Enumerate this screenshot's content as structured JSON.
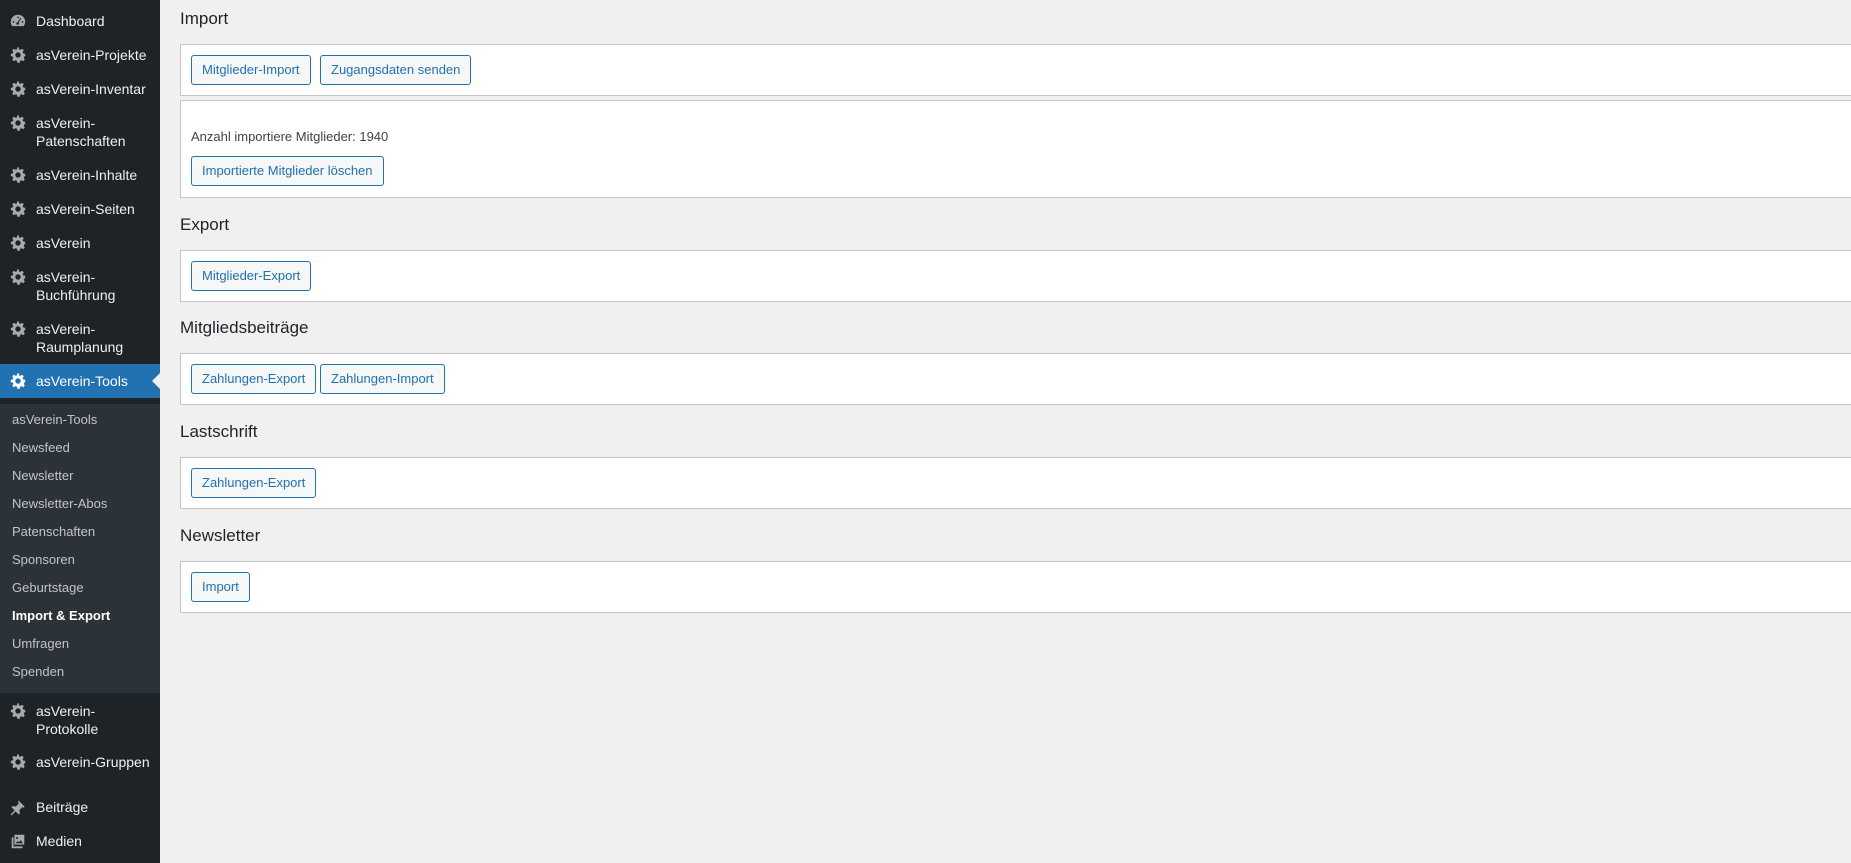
{
  "sidebar": {
    "items": [
      {
        "label": "Dashboard",
        "icon": "dashboard-icon"
      },
      {
        "label": "asVerein-Projekte",
        "icon": "gear-icon"
      },
      {
        "label": "asVerein-Inventar",
        "icon": "gear-icon"
      },
      {
        "label": "asVerein-Patenschaften",
        "line1": "asVerein-",
        "line2": "Patenschaften",
        "icon": "gear-icon"
      },
      {
        "label": "asVerein-Inhalte",
        "icon": "gear-icon"
      },
      {
        "label": "asVerein-Seiten",
        "icon": "gear-icon"
      },
      {
        "label": "asVerein",
        "icon": "gear-icon"
      },
      {
        "label": "asVerein-Buchführung",
        "line1": "asVerein-",
        "line2": "Buchführung",
        "icon": "gear-icon"
      },
      {
        "label": "asVerein-Raumplanung",
        "line1": "asVerein-",
        "line2": "Raumplanung",
        "icon": "gear-icon"
      },
      {
        "label": "asVerein-Tools",
        "icon": "gear-icon",
        "active": true
      },
      {
        "label": "asVerein-Protokolle",
        "line1": "asVerein-",
        "line2": "Protokolle",
        "icon": "gear-icon"
      },
      {
        "label": "asVerein-Gruppen",
        "icon": "gear-icon"
      },
      {
        "label": "Beiträge",
        "icon": "pin-icon"
      },
      {
        "label": "Medien",
        "icon": "media-icon"
      }
    ],
    "submenu": [
      {
        "label": "asVerein-Tools"
      },
      {
        "label": "Newsfeed"
      },
      {
        "label": "Newsletter"
      },
      {
        "label": "Newsletter-Abos"
      },
      {
        "label": "Patenschaften"
      },
      {
        "label": "Sponsoren"
      },
      {
        "label": "Geburtstage"
      },
      {
        "label": "Import & Export",
        "current": true
      },
      {
        "label": "Umfragen"
      },
      {
        "label": "Spenden"
      }
    ]
  },
  "main": {
    "import": {
      "title": "Import",
      "buttons": [
        "Mitglieder-Import",
        "Zugangsdaten senden"
      ],
      "count_label": "Anzahl importiere Mitglieder: 1940",
      "delete_button": "Importierte Mitglieder löschen"
    },
    "export": {
      "title": "Export",
      "buttons": [
        "Mitglieder-Export"
      ]
    },
    "beitraege": {
      "title": "Mitgliedsbeiträge",
      "buttons": [
        "Zahlungen-Export",
        "Zahlungen-Import"
      ]
    },
    "lastschrift": {
      "title": "Lastschrift",
      "buttons": [
        "Zahlungen-Export"
      ]
    },
    "newsletter": {
      "title": "Newsletter",
      "buttons": [
        "Import"
      ]
    }
  },
  "colors": {
    "sidebar_bg": "#1d2327",
    "submenu_bg": "#2c3338",
    "accent": "#2271b1",
    "page_bg": "#f0f0f1"
  }
}
